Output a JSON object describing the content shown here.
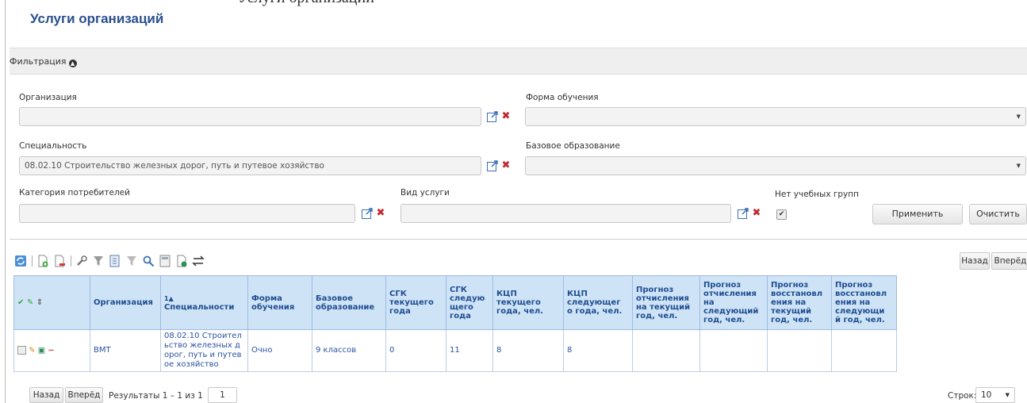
{
  "doc_fragment": "Услуги организаций",
  "page": {
    "title": "Услуги организаций"
  },
  "filter": {
    "title": "Фильтрация",
    "organization_label": "Организация",
    "organization_value": "",
    "study_form_label": "Форма обучения",
    "study_form_value": "",
    "specialty_label": "Специальность",
    "specialty_value": "08.02.10 Строительство железных дорог, путь и путевое хозяйство",
    "base_education_label": "Базовое образование",
    "base_education_value": "",
    "consumer_category_label": "Категория потребителей",
    "consumer_category_value": "",
    "service_type_label": "Вид услуги",
    "service_type_value": "",
    "no_groups_label": "Нет учебных групп",
    "no_groups_checked": true,
    "apply_label": "Применить",
    "clear_label": "Очистить"
  },
  "nav": {
    "back": "Назад",
    "forward": "Вперёд"
  },
  "table": {
    "sort_marker": "1▲",
    "columns": [
      "Организация",
      "Специальности",
      "Форма обучения",
      "Базовое образование",
      "СГК текущего года",
      "СГК следующего года",
      "КЦП текущего года, чел.",
      "КЦП следующего года, чел.",
      "Прогноз отчисления на текущий год, чел.",
      "Прогноз отчисления на следующий год, чел.",
      "Прогноз восстановления на текущий год, чел.",
      "Прогноз восстановления на следующий год, чел."
    ],
    "column_display": [
      "Организация",
      "Специальности",
      "Форма\nобучения",
      "Базовое\nобразование",
      "СГК\nтекущего\nгода",
      "СГК\nследую\nщего\nгода",
      "КЦП\nтекущего\nгода, чел.",
      "КЦП\nследующег\nо года, чел.",
      "Прогноз\nотчисления\nна текущий\nгод, чел.",
      "Прогноз\nотчисления\nна\nследующий\nгод, чел.",
      "Прогноз\nвосстановл\nения на\nтекущий\nгод, чел.",
      "Прогноз\nвосстановл\nения на\nследующи\nй год, чел."
    ],
    "rows": [
      {
        "organization": "ВМТ",
        "specialty": "08.02.10 Строительство железных дорог, путь и путевое хозяйство",
        "specialty_display": "08.02.10 Строител\nьство железных д\nорог, путь и путев\nое хозяйство",
        "study_form": "Очно",
        "base_education": "9 классов",
        "sgk_current": "0",
        "sgk_next": "11",
        "kcp_current": "8",
        "kcp_next": "8",
        "forecast_exp_current": "",
        "forecast_exp_next": "",
        "forecast_rest_current": "",
        "forecast_rest_next": ""
      }
    ]
  },
  "pager": {
    "results": "Результаты 1 – 1 из 1",
    "page": "1",
    "rows_label": "Строк:",
    "rows_value": "10"
  }
}
